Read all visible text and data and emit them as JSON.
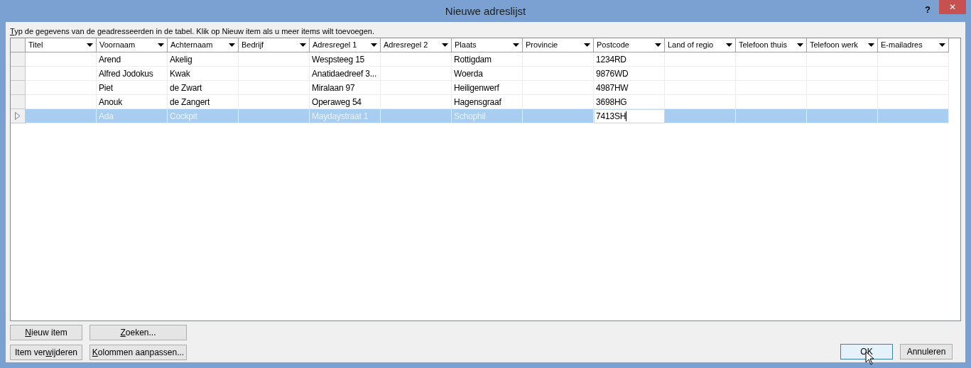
{
  "window": {
    "title": "Nieuwe adreslijst",
    "help": "?",
    "close": "✕"
  },
  "instruction": {
    "access_key": "T",
    "text_after": "yp de gegevens van de geadresseerden in de tabel. Klik op Nieuw item als u meer items wilt toevoegen."
  },
  "table": {
    "columns": [
      "Titel",
      "Voornaam",
      "Achternaam",
      "Bedrijf",
      "Adresregel 1",
      "Adresregel 2",
      "Plaats",
      "Provincie",
      "Postcode",
      "Land of regio",
      "Telefoon thuis",
      "Telefoon werk",
      "E-mailadres"
    ],
    "rows": [
      {
        "selected": false,
        "cells": [
          null,
          {
            "text": "Arend",
            "editing": false
          },
          {
            "text": "Akelig",
            "editing": false
          },
          null,
          {
            "text": "Wespsteeg 15",
            "editing": false
          },
          null,
          {
            "text": "Rottigdam",
            "editing": false
          },
          null,
          {
            "text": "1234RD",
            "editing": false
          },
          null,
          null,
          null,
          null
        ]
      },
      {
        "selected": false,
        "cells": [
          null,
          {
            "text": "Alfred Jodokus",
            "editing": false
          },
          {
            "text": "Kwak",
            "editing": false
          },
          null,
          {
            "text": "Anatidaedreef 3...",
            "editing": false
          },
          null,
          {
            "text": "Woerda",
            "editing": false
          },
          null,
          {
            "text": "9876WD",
            "editing": false
          },
          null,
          null,
          null,
          null
        ]
      },
      {
        "selected": false,
        "cells": [
          null,
          {
            "text": "Piet",
            "editing": false
          },
          {
            "text": "de Zwart",
            "editing": false
          },
          null,
          {
            "text": "Miralaan 97",
            "editing": false
          },
          null,
          {
            "text": "Heiligenwerf",
            "editing": false
          },
          null,
          {
            "text": "4987HW",
            "editing": false
          },
          null,
          null,
          null,
          null
        ]
      },
      {
        "selected": false,
        "cells": [
          null,
          {
            "text": "Anouk",
            "editing": false
          },
          {
            "text": "de Zangert",
            "editing": false
          },
          null,
          {
            "text": "Operaweg 54",
            "editing": false
          },
          null,
          {
            "text": "Hagensgraaf",
            "editing": false
          },
          null,
          {
            "text": "3698HG",
            "editing": false
          },
          null,
          null,
          null,
          null
        ]
      },
      {
        "selected": true,
        "cells": [
          null,
          {
            "text": "Ada",
            "editing": false
          },
          {
            "text": "Cockpit",
            "editing": false
          },
          null,
          {
            "text": "Maydaystraat 1",
            "editing": false
          },
          null,
          {
            "text": "Schophil",
            "editing": false
          },
          null,
          {
            "text": "7413SH",
            "editing": true
          },
          null,
          null,
          null,
          null
        ]
      }
    ]
  },
  "left_buttons": [
    {
      "access_key": "N",
      "text_after": "ieuw item"
    },
    {
      "access_key": "Z",
      "text_after": "oeken..."
    },
    {
      "text_before": "Item ver",
      "access_key": "w",
      "text_after": "ijderen"
    },
    {
      "access_key": "K",
      "text_after": "olommen aanpassen..."
    }
  ],
  "right_buttons": [
    {
      "label": "OK",
      "default": true
    },
    {
      "label": "Annuleren",
      "default": false
    }
  ]
}
